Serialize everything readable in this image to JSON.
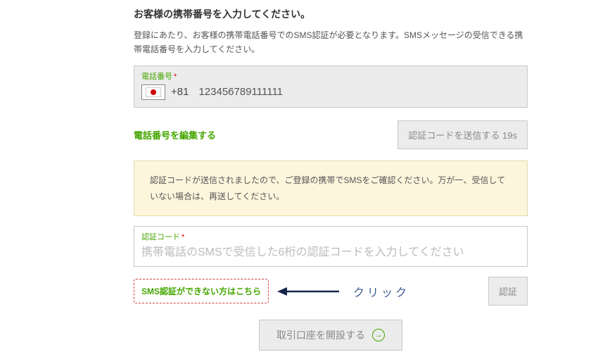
{
  "heading": "お客様の携帯番号を入力してください。",
  "description": "登録にあたり、お客様の携帯電話番号でのSMS認証が必要となります。SMSメッセージの受信できる携帯電話番号を入力してください。",
  "phone": {
    "label": "電話番号",
    "required_mark": "*",
    "dial_code": "+81",
    "number": "123456789111111"
  },
  "edit_link": "電話番号を編集する",
  "send_button": "認証コードを送信する 19s",
  "notice": "認証コードが送信されましたので、ご登録の携帯でSMSをご確認ください。万が一、受信していない場合は、再送してください。",
  "code": {
    "label": "認証コード",
    "required_mark": "*",
    "placeholder": "携帯電話のSMSで受信した6桁の認証コードを入力してください"
  },
  "sms_help_link": "SMS認証ができない方はこちら",
  "click_annotation": "クリック",
  "verify_button": "認証",
  "open_account_button": "取引口座を開設する"
}
